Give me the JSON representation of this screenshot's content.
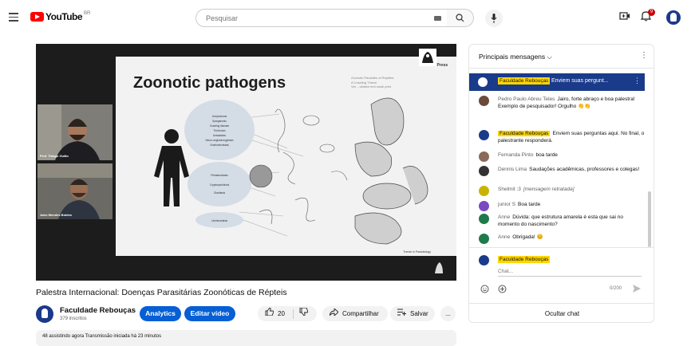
{
  "header": {
    "logo_text": "YouTube",
    "logo_country": "BR",
    "search_placeholder": "Pesquisar",
    "notification_count": "9"
  },
  "video": {
    "title": "Palestra Internacional: Doenças Parasitárias Zoonóticas de Répteis",
    "channel_name": "Faculdade Rebouças",
    "subscribers": "379 inscritos",
    "analytics_label": "Analytics",
    "edit_label": "Editar vídeo",
    "likes": "20",
    "share_label": "Compartilhar",
    "save_label": "Salvar",
    "more_label": "...",
    "description_text": "48 assistindo agora  Transmissão iniciada há 23 minutos"
  },
  "slide": {
    "title": "Zoonotic pathogens",
    "reference_lines": [
      "Zoonotic Parasites of Reptiles:",
      "A Crawling Threat",
      "Ver. - citation text small print"
    ],
    "publisher": "Cell Press",
    "footer": "Trends in Parasitology",
    "center_labels": [
      "Ancylostoma",
      "Sparganosis",
      "Crawling disease",
      "Trichinosis",
      "Anisakiasis",
      "Neuro-angiostrongyliasis",
      "Gnathostomiasis",
      "Pentastomiasis",
      "Cryptosporidiosis",
      "Giardiasis",
      "Leishmaniasis"
    ]
  },
  "cameras": [
    {
      "label": "Prof. Thiago Guião"
    },
    {
      "label": "Jairo Mendes Boldes"
    }
  ],
  "chat": {
    "header_title": "Principais mensagens",
    "pinned": {
      "author": "Faculdade Rebouças",
      "text": "Enviem suas pergunt..."
    },
    "messages": [
      {
        "author": "Pedro Paulo Abreu Teles",
        "text": "Jairo, forte abraço e boa palestra! Exemplo de pesquisador! Orgulho",
        "highlight": false
      },
      {
        "author": "Faculdade Rebouças",
        "text": "Enviem suas perguntas aqui. No final, o palestrante responderá.",
        "highlight": true
      },
      {
        "author": "Fernanda Pinto",
        "text": "boa tarde",
        "highlight": false
      },
      {
        "author": "Dennis Lima",
        "text": "Saudações acadêmicas, professores e colegas!",
        "highlight": false
      },
      {
        "author": "Shelmit :3",
        "text": "[mensagem retratada]",
        "highlight": false
      },
      {
        "author": "junior S",
        "text": "Boa tarde",
        "highlight": false
      },
      {
        "author": "Anne",
        "text": "Dúvida: que estrutura amarela é esta que sai no momento do nascimento?",
        "highlight": false
      },
      {
        "author": "Anne",
        "text": "Obrigada!",
        "highlight": false
      }
    ],
    "input_author": "Faculdade Rebouças",
    "input_placeholder": "Chat...",
    "char_count": "0/200",
    "hide_label": "Ocultar chat"
  },
  "colors": {
    "brand_red": "#ff0000",
    "accent_blue": "#065fd4",
    "pinned_bg": "#1a3a8a",
    "highlight_yellow": "#ffd600"
  }
}
